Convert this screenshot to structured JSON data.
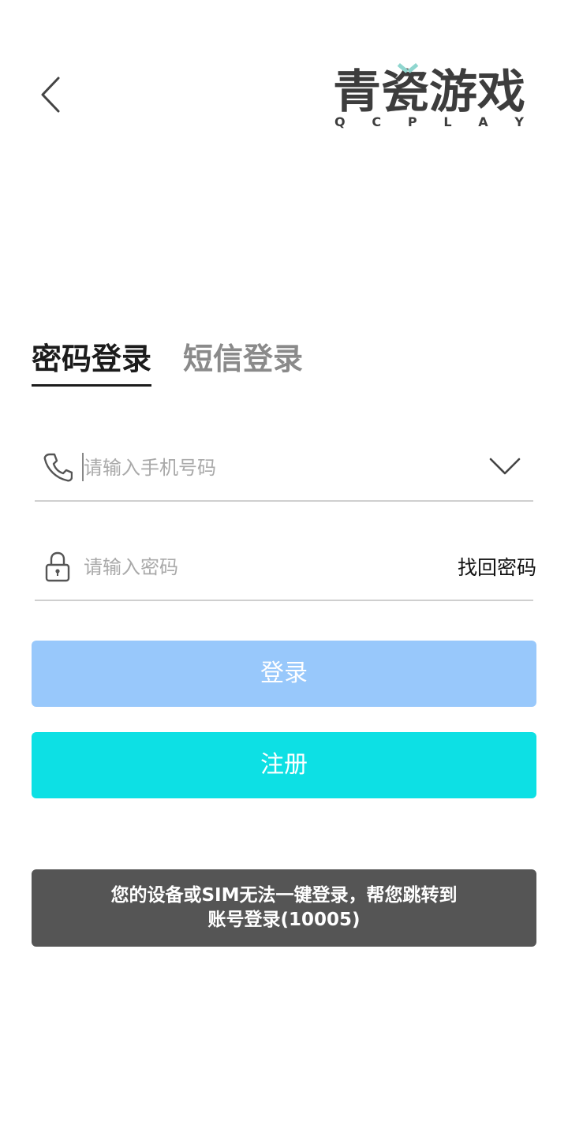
{
  "brand": {
    "name_cn": "青瓷游戏",
    "name_en": "Q C P L A Y",
    "text_color": "#3d3d3d",
    "accent_color": "#8fd6cf"
  },
  "header": {
    "back_icon": "chevron-left-icon"
  },
  "tabs": [
    {
      "label": "密码登录",
      "active": true
    },
    {
      "label": "短信登录",
      "active": false
    }
  ],
  "phone_field": {
    "icon": "phone-icon",
    "placeholder": "请输入手机号码",
    "value": "",
    "dropdown_icon": "chevron-down-icon"
  },
  "password_field": {
    "icon": "lock-icon",
    "placeholder": "请输入密码",
    "value": "",
    "forgot_label": "找回密码"
  },
  "buttons": {
    "login_label": "登录",
    "login_color": "#98c8fb",
    "register_label": "注册",
    "register_color": "#0de0e4"
  },
  "toast": {
    "line1": "您的设备或SIM无法一键登录，帮您跳转到",
    "line2": "账号登录(10005)",
    "background": "#555555"
  }
}
